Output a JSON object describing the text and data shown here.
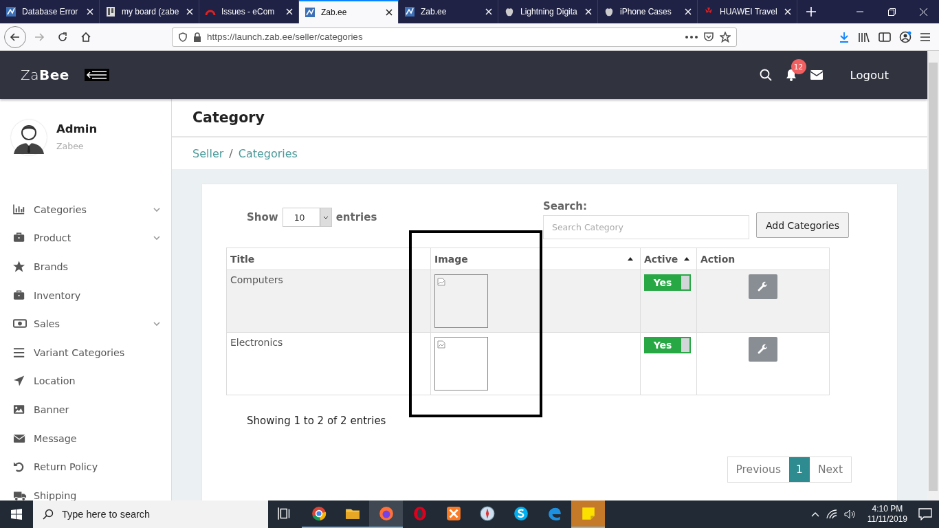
{
  "browser": {
    "tabs": [
      {
        "title": "Database Error",
        "selected": false
      },
      {
        "title": "my board (zabe",
        "selected": false
      },
      {
        "title": "Issues - eCom",
        "selected": false
      },
      {
        "title": "Zab.ee",
        "selected": true
      },
      {
        "title": "Zab.ee",
        "selected": false
      },
      {
        "title": "Lightning Digita",
        "selected": false
      },
      {
        "title": "iPhone Cases",
        "selected": false
      },
      {
        "title": "HUAWEI Travel",
        "selected": false
      }
    ],
    "url": "https://launch.zab.ee/seller/categories",
    "forward_disabled": true
  },
  "header": {
    "logo": "Za**Bee**",
    "notification_count": "12",
    "logout": "Logout"
  },
  "user": {
    "name": "Admin",
    "role": "Zabee"
  },
  "sidebar": {
    "items": [
      {
        "label": "Categories",
        "expandable": true
      },
      {
        "label": "Product",
        "expandable": true
      },
      {
        "label": "Brands",
        "expandable": false
      },
      {
        "label": "Inventory",
        "expandable": false
      },
      {
        "label": "Sales",
        "expandable": true
      },
      {
        "label": "Variant Categories",
        "expandable": false
      },
      {
        "label": "Location",
        "expandable": false
      },
      {
        "label": "Banner",
        "expandable": false
      },
      {
        "label": "Message",
        "expandable": false
      },
      {
        "label": "Return Policy",
        "expandable": false
      },
      {
        "label": "Shipping",
        "expandable": false
      }
    ]
  },
  "page": {
    "title": "Category",
    "breadcrumb": [
      "Seller",
      "Categories"
    ],
    "breadcrumb_separator": "/"
  },
  "table": {
    "show_label": "Show",
    "page_size": "10",
    "entries_label": "entries",
    "search_label": "Search:",
    "search": {
      "placeholder": "Search Category"
    },
    "add_button": "Add Categories",
    "columns": [
      {
        "label": "Title",
        "sortable": false
      },
      {
        "label": "Image",
        "sortable": true
      },
      {
        "label": "Active",
        "sortable": true
      },
      {
        "label": "Action",
        "sortable": false
      }
    ],
    "rows": [
      {
        "title": "Computers",
        "active": true,
        "toggle_label": "Yes",
        "shaded": true
      },
      {
        "title": "Electronics",
        "active": true,
        "toggle_label": "Yes",
        "shaded": false
      }
    ],
    "info": "Showing 1 to 2 of 2 entries",
    "pagination": {
      "previous": "Previous",
      "pages": [
        {
          "label": "1",
          "selected": true
        }
      ],
      "next": "Next"
    }
  },
  "taskbar": {
    "search": {
      "placeholder": "Type here to search"
    },
    "apps": [
      {
        "running": false,
        "focused": false
      },
      {
        "running": true,
        "focused": false
      },
      {
        "running": true,
        "focused": false
      },
      {
        "running": true,
        "focused": true
      },
      {
        "running": false,
        "focused": false
      },
      {
        "running": false,
        "focused": false
      },
      {
        "running": false,
        "focused": false
      },
      {
        "running": false,
        "focused": false
      },
      {
        "running": false,
        "focused": false
      },
      {
        "running": true,
        "focused": true
      }
    ],
    "time": "4:10 PM",
    "date": "11/11/2019"
  }
}
